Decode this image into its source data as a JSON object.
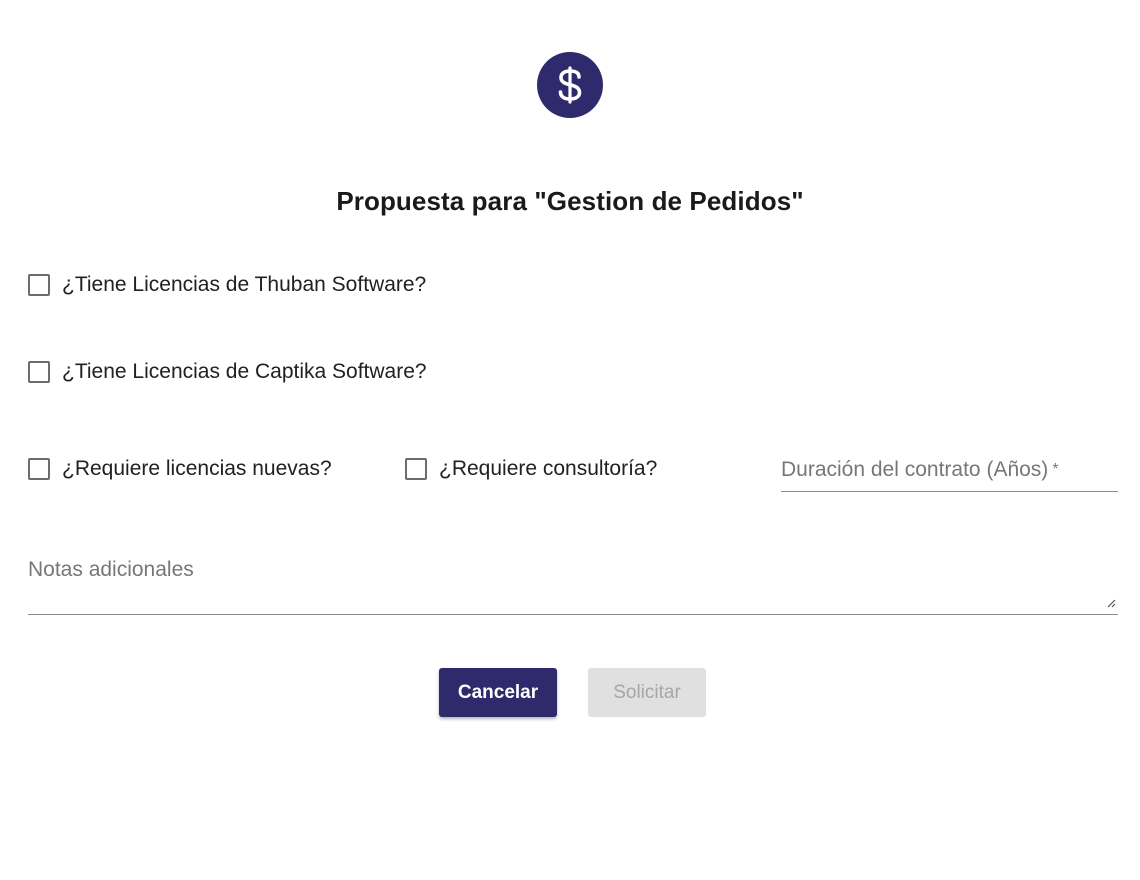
{
  "header": {
    "icon": "dollar-icon",
    "icon_bg_color": "#2f2a6b"
  },
  "title": "Propuesta para \"Gestion de Pedidos\"",
  "checkboxes": {
    "thuban": {
      "label": "¿Tiene Licencias de Thuban Software?",
      "checked": false
    },
    "captika": {
      "label": "¿Tiene Licencias de Captika Software?",
      "checked": false
    },
    "new_licenses": {
      "label": "¿Requiere licencias nuevas?",
      "checked": false
    },
    "consulting": {
      "label": "¿Requiere consultoría?",
      "checked": false
    }
  },
  "duration": {
    "label": "Duración del contrato (Años)",
    "required_mark": "*",
    "value": ""
  },
  "notes": {
    "label": "Notas adicionales",
    "value": ""
  },
  "actions": {
    "cancel_label": "Cancelar",
    "submit_label": "Solicitar",
    "primary_color": "#2f2a6b",
    "disabled_color": "#e0e0e0"
  }
}
